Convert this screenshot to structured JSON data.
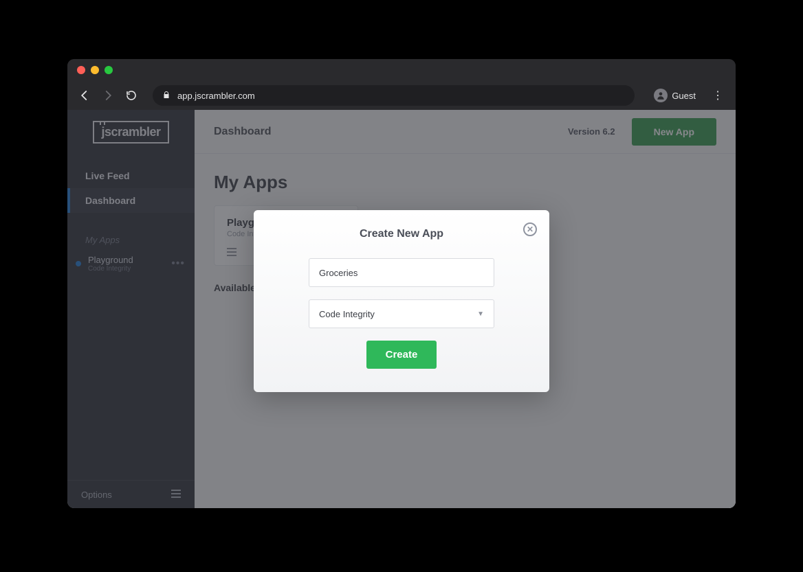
{
  "browser": {
    "url": "app.jscrambler.com",
    "guest": "Guest"
  },
  "sidebar": {
    "logo": "jscrambler",
    "items": [
      {
        "label": "Live Feed"
      },
      {
        "label": "Dashboard"
      }
    ],
    "section_label": "My Apps",
    "apps": [
      {
        "name": "Playground",
        "sub": "Code Integrity"
      }
    ],
    "footer": "Options"
  },
  "topbar": {
    "title": "Dashboard",
    "version": "Version 6.2",
    "new_app": "New App"
  },
  "content": {
    "heading": "My Apps",
    "card": {
      "title": "Playground",
      "sub": "Code Integrity"
    },
    "available": "Available"
  },
  "modal": {
    "title": "Create New App",
    "name_value": "Groceries",
    "type_selected": "Code Integrity",
    "create": "Create"
  }
}
